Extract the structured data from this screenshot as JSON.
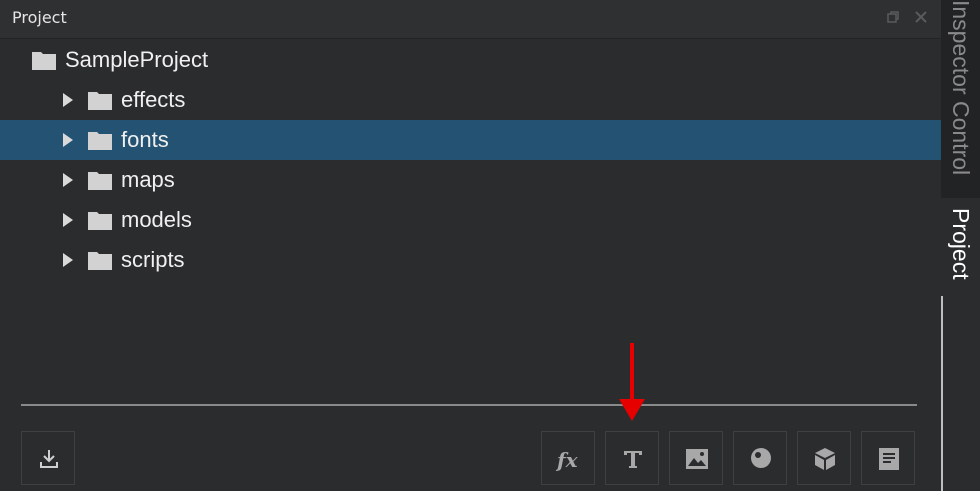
{
  "panel": {
    "title": "Project",
    "restore_icon": "restore-icon",
    "close_icon": "close-icon"
  },
  "tree": {
    "root": {
      "label": "SampleProject",
      "icon": "folder-icon"
    },
    "items": [
      {
        "label": "effects",
        "selected": false
      },
      {
        "label": "fonts",
        "selected": true
      },
      {
        "label": "maps",
        "selected": false
      },
      {
        "label": "models",
        "selected": false
      },
      {
        "label": "scripts",
        "selected": false
      }
    ]
  },
  "toolbar": {
    "import_icon": "import-icon",
    "buttons": [
      {
        "name": "fx",
        "icon": "fx-icon"
      },
      {
        "name": "text",
        "icon": "text-icon"
      },
      {
        "name": "image",
        "icon": "image-icon"
      },
      {
        "name": "material",
        "icon": "sphere-icon"
      },
      {
        "name": "model",
        "icon": "cube-icon"
      },
      {
        "name": "script",
        "icon": "document-icon"
      }
    ]
  },
  "side_tabs": {
    "inspector": "Inspector Control",
    "project": "Project"
  },
  "colors": {
    "background": "#2b2c2e",
    "selection": "#245272",
    "annotation": "#e60000"
  }
}
